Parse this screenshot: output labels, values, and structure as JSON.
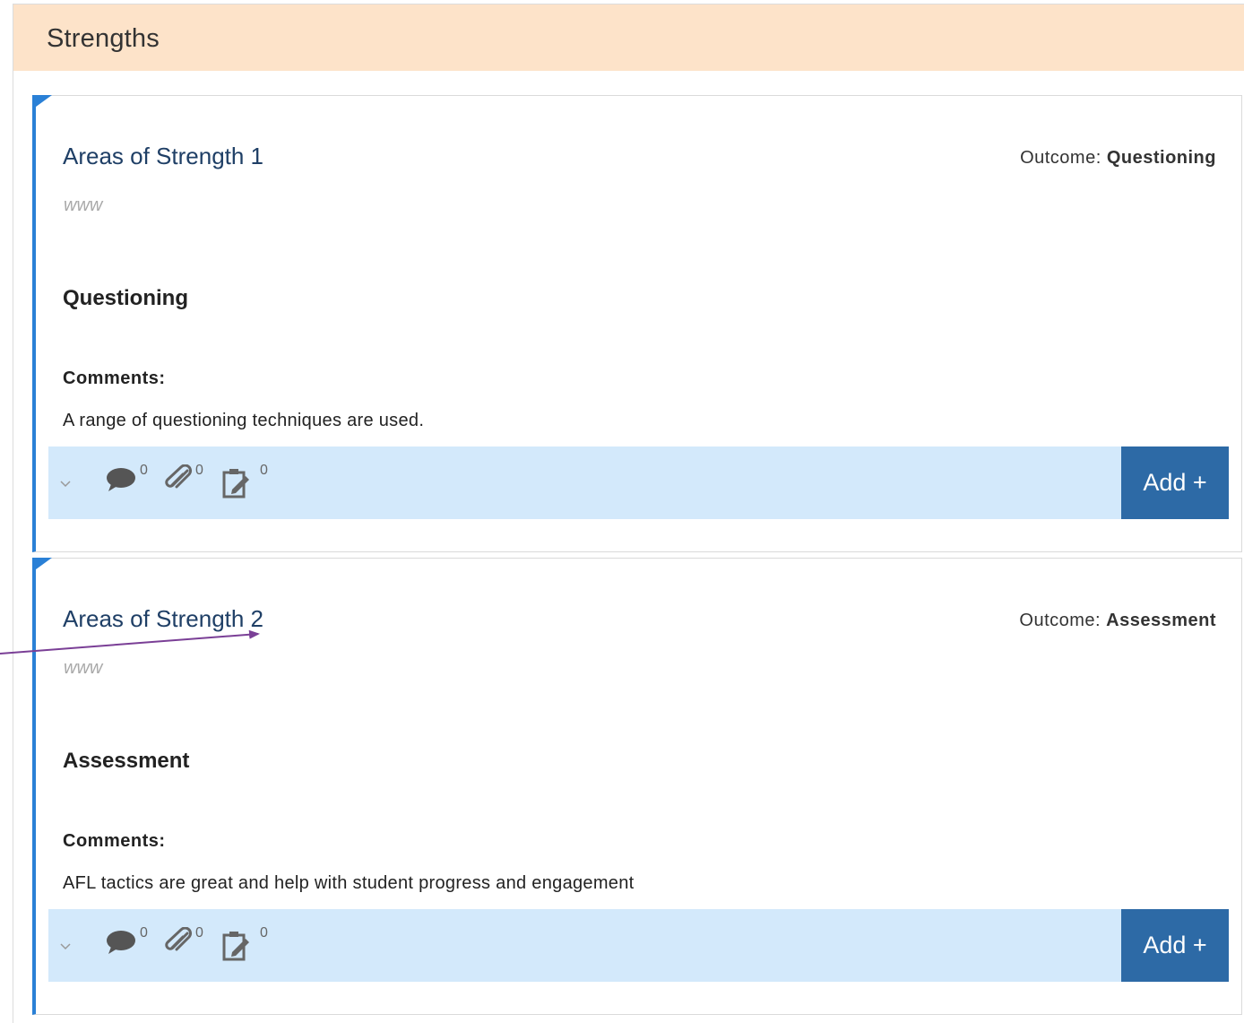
{
  "section": {
    "title": "Strengths"
  },
  "cards": [
    {
      "title": "Areas of Strength 1",
      "subtitle": "www",
      "outcome_label": "Outcome:",
      "outcome_value": "Questioning",
      "focus": "Questioning",
      "comments_label": "Comments:",
      "comments": "A range of questioning techniques are used.",
      "counts": {
        "comments": "0",
        "attachments": "0",
        "notes": "0"
      },
      "add_label": "Add +"
    },
    {
      "title": "Areas of Strength 2",
      "subtitle": "www",
      "outcome_label": "Outcome:",
      "outcome_value": "Assessment",
      "focus": "Assessment",
      "comments_label": "Comments:",
      "comments": "AFL tactics are great and help with student progress and engagement",
      "counts": {
        "comments": "0",
        "attachments": "0",
        "notes": "0"
      },
      "add_label": "Add +"
    }
  ],
  "icons": {
    "expand": "chevron-down-icon",
    "comment": "speech-bubble-icon",
    "attachment": "paperclip-icon",
    "note": "clipboard-edit-icon"
  },
  "colors": {
    "header_bg": "#fde3c9",
    "accent": "#2a80d6",
    "toolbar_bg": "#d3e9fb",
    "button_bg": "#2d6aa6",
    "annotation_arrow": "#7a3f96"
  }
}
